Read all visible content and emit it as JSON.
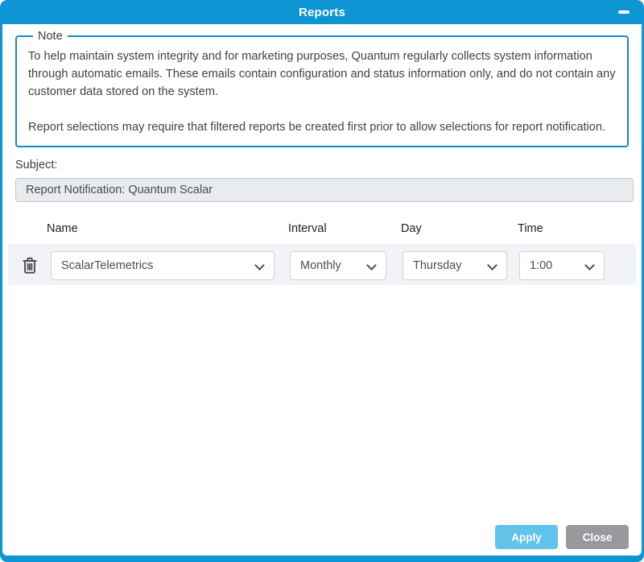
{
  "dialog": {
    "title": "Reports"
  },
  "note": {
    "legend": "Note",
    "paragraph1": "To help maintain system integrity and for marketing purposes, Quantum regularly collects system information through automatic emails. These emails contain configuration and status information only, and do not contain any customer data stored on the system.",
    "paragraph2": "Report selections may require that filtered reports be created first prior to allow selections for report notification."
  },
  "subject": {
    "label": "Subject:",
    "value": "Report Notification: Quantum Scalar"
  },
  "schedule": {
    "headers": [
      "Name",
      "Interval",
      "Day",
      "Time"
    ],
    "rows": [
      {
        "name": "ScalarTelemetrics",
        "interval": "Monthly",
        "day": "Thursday",
        "time": "1:00"
      }
    ]
  },
  "footer": {
    "apply_label": "Apply",
    "close_label": "Close"
  },
  "colors": {
    "accent_blue": "#0e95d4",
    "fieldset_border_blue": "#1389cd",
    "apply_blue": "#5fc3ea",
    "close_gray": "#97999c",
    "row_background": "#f1f3f6",
    "readonly_input_background": "#e9ecef"
  }
}
